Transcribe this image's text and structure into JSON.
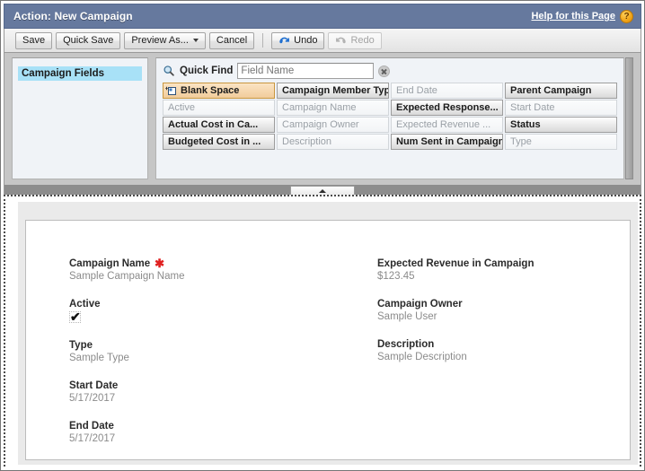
{
  "window": {
    "title": "Action: New Campaign",
    "help_link": "Help for this Page",
    "help_badge": "?"
  },
  "toolbar": {
    "save_label": "Save",
    "quick_save_label": "Quick Save",
    "preview_as_label": "Preview As...",
    "cancel_label": "Cancel",
    "undo_label": "Undo",
    "redo_label": "Redo"
  },
  "palette": {
    "categories": [
      {
        "label": "Campaign Fields",
        "selected": true
      }
    ],
    "quick_find": {
      "label": "Quick Find",
      "value": "",
      "placeholder": "Field Name",
      "clear_icon": "close-icon"
    },
    "fields": [
      {
        "label": "Blank Space",
        "state": "blank"
      },
      {
        "label": "Campaign Member Type",
        "state": "available"
      },
      {
        "label": "End Date",
        "state": "used"
      },
      {
        "label": "Parent Campaign",
        "state": "available"
      },
      {
        "label": "Active",
        "state": "used"
      },
      {
        "label": "Campaign Name",
        "state": "used"
      },
      {
        "label": "Expected Response...",
        "state": "available"
      },
      {
        "label": "Start Date",
        "state": "used"
      },
      {
        "label": "Actual Cost in Ca...",
        "state": "available"
      },
      {
        "label": "Campaign Owner",
        "state": "used"
      },
      {
        "label": "Expected Revenue ...",
        "state": "used"
      },
      {
        "label": "Status",
        "state": "available"
      },
      {
        "label": "Budgeted Cost in ...",
        "state": "available"
      },
      {
        "label": "Description",
        "state": "used"
      },
      {
        "label": "Num Sent in Campaign",
        "state": "available"
      },
      {
        "label": "Type",
        "state": "used"
      }
    ]
  },
  "splitter": {
    "handle_icon": "collapse-up-icon"
  },
  "preview": {
    "left_fields": [
      {
        "label": "Campaign Name",
        "value": "Sample Campaign Name",
        "required": true,
        "type": "text"
      },
      {
        "label": "Active",
        "value": "✔",
        "required": false,
        "type": "checkbox"
      },
      {
        "label": "Type",
        "value": "Sample Type",
        "required": false,
        "type": "text"
      },
      {
        "label": "Start Date",
        "value": "5/17/2017",
        "required": false,
        "type": "text"
      },
      {
        "label": "End Date",
        "value": "5/17/2017",
        "required": false,
        "type": "text"
      }
    ],
    "right_fields": [
      {
        "label": "Expected Revenue in Campaign",
        "value": "$123.45",
        "required": false,
        "type": "text"
      },
      {
        "label": "Campaign Owner",
        "value": "Sample User",
        "required": false,
        "type": "text"
      },
      {
        "label": "Description",
        "value": "Sample Description",
        "required": false,
        "type": "text"
      }
    ]
  },
  "colors": {
    "titlebar": "#66799e",
    "category_selected": "#a8e1f7",
    "blank_space": "#f1cc9b",
    "required_star": "#e02020",
    "undo_blue": "#1f6fd0"
  }
}
